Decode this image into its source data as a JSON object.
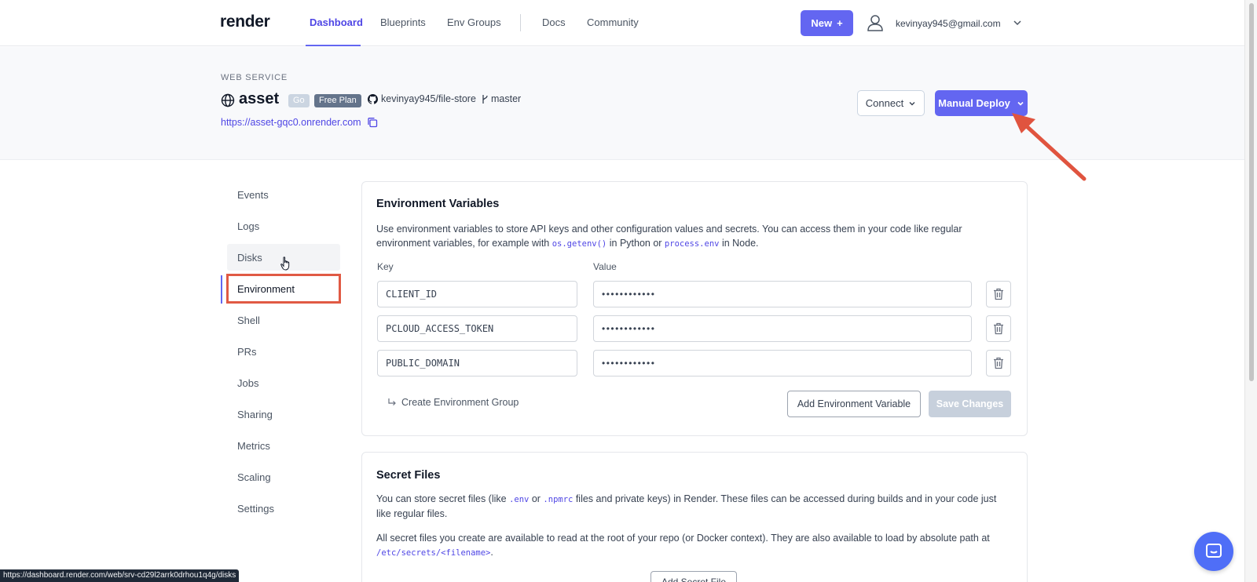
{
  "nav": {
    "logo": "render",
    "links": [
      "Dashboard",
      "Blueprints",
      "Env Groups",
      "Docs",
      "Community"
    ],
    "new_label": "New",
    "user_email": "kevinyay945@gmail.com"
  },
  "service": {
    "type": "WEB SERVICE",
    "name": "asset",
    "badges": [
      "Go",
      "Free Plan"
    ],
    "repo": "kevinyay945/file-store",
    "branch": "master",
    "url": "https://asset-gqc0.onrender.com",
    "connect_label": "Connect",
    "deploy_label": "Manual Deploy"
  },
  "sidebar": {
    "items": [
      "Events",
      "Logs",
      "Disks",
      "Environment",
      "Shell",
      "PRs",
      "Jobs",
      "Sharing",
      "Metrics",
      "Scaling",
      "Settings"
    ],
    "active": "Environment"
  },
  "env": {
    "title": "Environment Variables",
    "desc_1": "Use environment variables to store API keys and other configuration values and secrets. You can access them in your code like regular environment variables, for example with ",
    "code_1": "os.getenv()",
    "desc_2": " in Python or ",
    "code_2": "process.env",
    "desc_3": " in Node.",
    "key_label": "Key",
    "value_label": "Value",
    "vars": [
      {
        "key": "CLIENT_ID",
        "value": "••••••••••••"
      },
      {
        "key": "PCLOUD_ACCESS_TOKEN",
        "value": "••••••••••••"
      },
      {
        "key": "PUBLIC_DOMAIN",
        "value": "••••••••••••"
      }
    ],
    "create_group_label": "Create Environment Group",
    "add_label": "Add Environment Variable",
    "save_label": "Save Changes"
  },
  "secrets": {
    "title": "Secret Files",
    "p1_a": "You can store secret files (like ",
    "p1_code1": ".env",
    "p1_b": " or ",
    "p1_code2": ".npmrc",
    "p1_c": " files and private keys) in Render. These files can be accessed during builds and in your code just like regular files.",
    "p2_a": "All secret files you create are available to read at the root of your repo (or Docker context). They are also available to load by absolute path at ",
    "p2_code": "/etc/secrets/<filename>",
    "p2_b": ".",
    "add_label": "Add Secret File"
  },
  "status_url": "https://dashboard.render.com/web/srv-cd29l2arrk0drhou1q4g/disks",
  "colors": {
    "accent": "#6366f1",
    "highlight": "#e05a44",
    "link": "#4f46e5"
  }
}
